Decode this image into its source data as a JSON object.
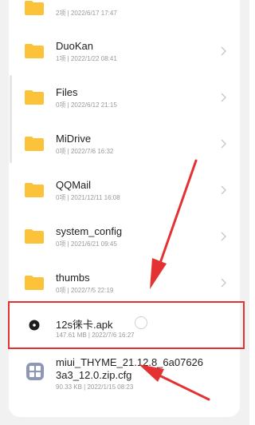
{
  "files": [
    {
      "name": "",
      "meta": "2项 | 2022/6/17 17:47"
    },
    {
      "name": "DuoKan",
      "meta": "1项 | 2022/1/22 08:41"
    },
    {
      "name": "Files",
      "meta": "0项 | 2022/6/12 21:15"
    },
    {
      "name": "MiDrive",
      "meta": "0项 | 2022/7/6 16:32"
    },
    {
      "name": "QQMail",
      "meta": "0项 | 2021/12/11 16:08"
    },
    {
      "name": "system_config",
      "meta": "0项 | 2021/6/21 09:45"
    },
    {
      "name": "thumbs",
      "meta": "0项 | 2022/7/5 22:19"
    }
  ],
  "selected_file": {
    "name": "12s徕卡.apk",
    "meta": "147.61 MB | 2022/7/6 16:27"
  },
  "cfg_file": {
    "name_line1": "miui_THYME_21.12.8_6a07626",
    "name_line2": "3a3_12.0.zip.cfg",
    "meta": "90.33 KB | 2022/1/15 08:23"
  },
  "colors": {
    "folder": "#fcc23a",
    "annotation": "#e43232",
    "cfg_icon": "#8e97b6"
  },
  "icons": {
    "folder": "folder-icon",
    "chevron": "chevron-right-icon",
    "apk": "apk-file-icon",
    "cfg": "cfg-file-icon"
  }
}
